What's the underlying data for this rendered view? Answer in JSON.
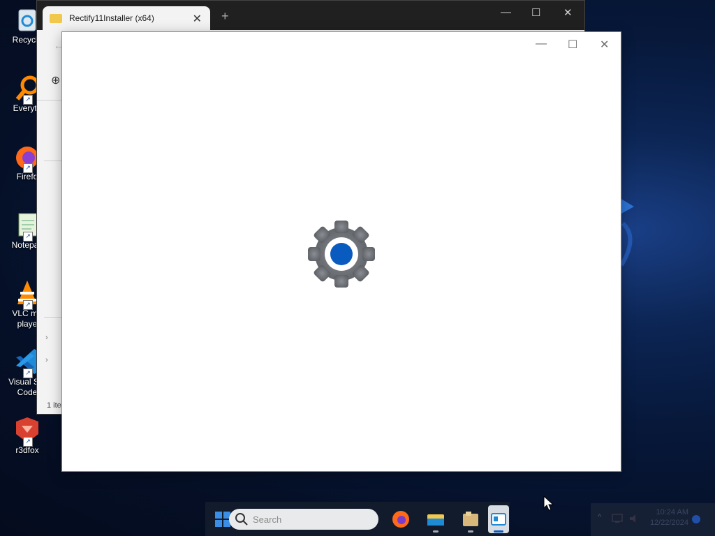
{
  "desktop_icons": [
    {
      "label": "Recycle",
      "icon": "recycle-bin-icon"
    },
    {
      "label": "Everyth",
      "icon": "everything-search-icon"
    },
    {
      "label": "Firefo",
      "icon": "firefox-icon"
    },
    {
      "label": "Notepac",
      "icon": "notepad-icon"
    },
    {
      "label": "VLC me",
      "label2": "playe",
      "icon": "vlc-icon"
    },
    {
      "label": "Visual Stu",
      "label2": "Code",
      "icon": "vscode-icon"
    },
    {
      "label": "r3dfox",
      "icon": "r3dfox-icon"
    }
  ],
  "explorer": {
    "tab_title": "Rectify11Installer (x64)",
    "status": "1 ite"
  },
  "settings_window": {
    "icon": "settings-gear-icon"
  },
  "taskbar": {
    "search_placeholder": "Search",
    "apps": [
      "firefox-icon",
      "file-explorer-icon",
      "folder-icon",
      "settings-app-icon"
    ]
  },
  "clock": {
    "time": "10:24 AM",
    "date": "12/22/2024"
  },
  "colors": {
    "accent": "#0a5bbf",
    "gear_gray": "#6f7378"
  }
}
